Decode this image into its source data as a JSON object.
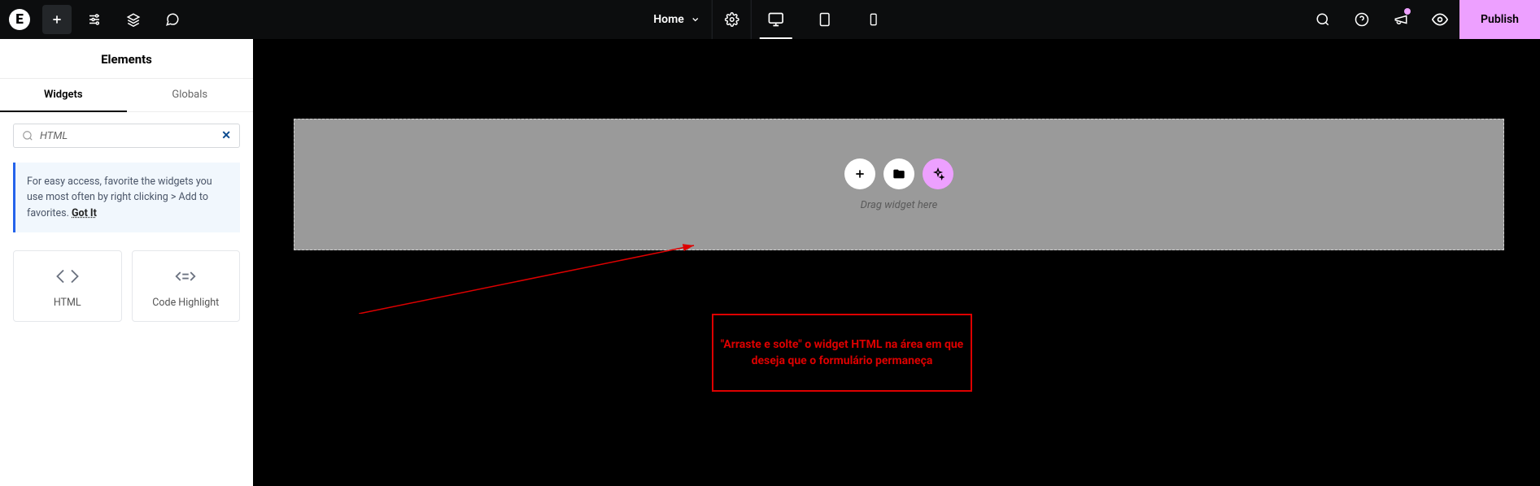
{
  "topbar": {
    "logo_letter": "E",
    "page_name": "Home",
    "publish_label": "Publish"
  },
  "panel": {
    "title": "Elements",
    "tabs": {
      "widgets": "Widgets",
      "globals": "Globals"
    },
    "search_value": "HTML",
    "tip_text": "For easy access, favorite the widgets you use most often by right clicking > Add to favorites.",
    "tip_action": "Got It",
    "widgets": [
      {
        "label": "HTML"
      },
      {
        "label": "Code Highlight"
      }
    ]
  },
  "canvas": {
    "drag_hint": "Drag widget here"
  },
  "annotation": {
    "text": "\"Arraste e solte\" o widget HTML na área em que deseja que o formulário permaneça"
  }
}
